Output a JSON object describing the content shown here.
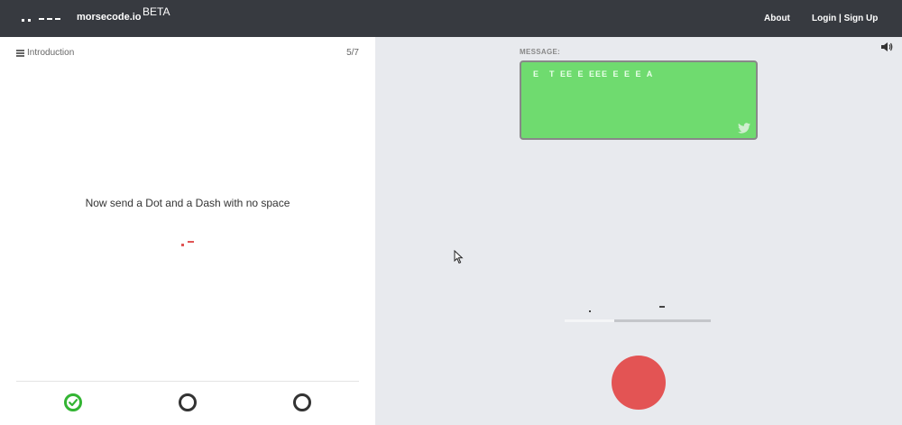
{
  "navbar": {
    "brand": "morsecode.io",
    "beta": "BETA",
    "about": "About",
    "login": "Login | Sign Up"
  },
  "lesson": {
    "section": "Introduction",
    "progress": "5/7",
    "instruction": "Now send a Dot and a Dash with no space",
    "target_morse": ".-",
    "steps": [
      {
        "status": "done",
        "icon": "check-icon"
      },
      {
        "status": "pending",
        "icon": "circle-icon"
      },
      {
        "status": "pending",
        "icon": "circle-icon"
      }
    ]
  },
  "practice": {
    "message_label": "MESSAGE:",
    "message_text": "E  T EE E EEE E E E A",
    "input_preview": ". -",
    "timeline_progress": 0.34
  },
  "colors": {
    "navbar_bg": "#373a40",
    "message_bg": "#6fdb6f",
    "accent_red": "#e35454",
    "check_green": "#33b433"
  }
}
